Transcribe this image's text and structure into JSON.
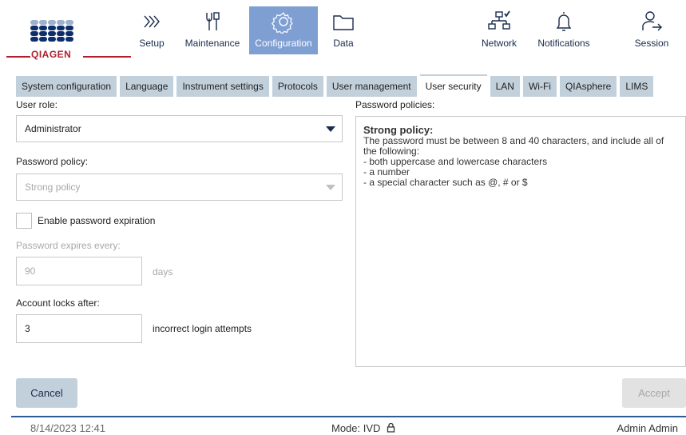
{
  "brand": {
    "name": "QIAGEN"
  },
  "nav": {
    "setup": "Setup",
    "maintenance": "Maintenance",
    "configuration": "Configuration",
    "data": "Data",
    "network": "Network",
    "notifications": "Notifications",
    "session": "Session",
    "active": "Configuration",
    "accent_color": "#7f9fd3"
  },
  "tabs": [
    {
      "label": "System configuration"
    },
    {
      "label": "Language"
    },
    {
      "label": "Instrument settings"
    },
    {
      "label": "Protocols"
    },
    {
      "label": "User management"
    },
    {
      "label": "User security",
      "active": true
    },
    {
      "label": "LAN"
    },
    {
      "label": "Wi-Fi"
    },
    {
      "label": "QIAsphere"
    },
    {
      "label": "LIMS"
    }
  ],
  "form": {
    "user_role_label": "User role:",
    "user_role_value": "Administrator",
    "password_policy_label": "Password policy:",
    "password_policy_value": "Strong policy",
    "expiration_checkbox_label": "Enable password expiration",
    "expiration_checked": false,
    "expires_every_label": "Password expires every:",
    "expires_every_value": "90",
    "expires_every_unit": "days",
    "account_locks_label": "Account locks after:",
    "account_locks_value": "3",
    "account_locks_unit": "incorrect login attempts"
  },
  "policies": {
    "label": "Password policies:",
    "title": "Strong policy:",
    "text": "The password must be between 8 and 40 characters, and include all of the following:\n- both uppercase and lowercase characters\n- a number\n- a special character such as @, # or $"
  },
  "buttons": {
    "cancel": "Cancel",
    "accept": "Accept"
  },
  "footer": {
    "datetime": "8/14/2023 12:41",
    "mode": "Mode: IVD",
    "user": "Admin Admin"
  }
}
